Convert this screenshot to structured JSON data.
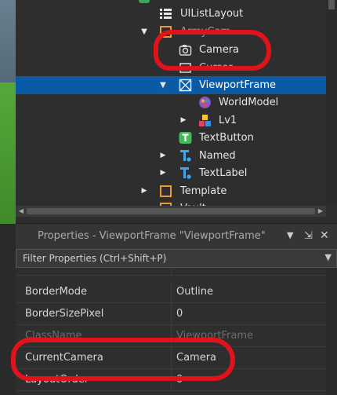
{
  "explorer": {
    "items": [
      {
        "label": "UIListLayout",
        "icon": "list-layout-icon"
      },
      {
        "label": "ArmyCam",
        "icon": "frame-icon"
      },
      {
        "label": "Camera",
        "icon": "camera-icon"
      },
      {
        "label": "Cursor",
        "icon": "image-icon"
      },
      {
        "label": "ViewportFrame",
        "icon": "viewport-frame-icon"
      },
      {
        "label": "WorldModel",
        "icon": "world-model-icon"
      },
      {
        "label": "Lv1",
        "icon": "model-icon"
      },
      {
        "label": "TextButton",
        "icon": "text-button-icon"
      },
      {
        "label": "Named",
        "icon": "text-label-icon"
      },
      {
        "label": "TextLabel",
        "icon": "text-label-icon"
      },
      {
        "label": "Template",
        "icon": "frame-icon"
      },
      {
        "label": "Vault",
        "icon": "frame-icon"
      }
    ]
  },
  "properties": {
    "title": "Properties - ViewportFrame \"ViewportFrame\"",
    "filter_placeholder": "Filter Properties (Ctrl+Shift+P)",
    "rows": [
      {
        "name": "BorderMode",
        "value": "Outline"
      },
      {
        "name": "BorderSizePixel",
        "value": "0"
      },
      {
        "name": "ClassName",
        "value": "ViewportFrame"
      },
      {
        "name": "CurrentCamera",
        "value": "Camera"
      },
      {
        "name": "LayoutOrder",
        "value": "0"
      }
    ]
  },
  "colors": {
    "selection": "#0b5aa5",
    "annotation": "#e0121c"
  }
}
